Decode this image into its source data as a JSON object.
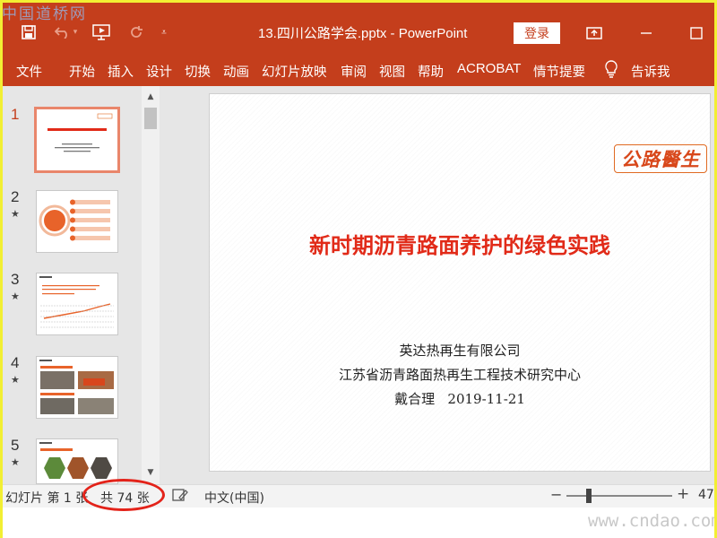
{
  "watermark": {
    "top": "中国道桥网",
    "bottom": "www.cndao.com"
  },
  "titlebar": {
    "title": "13.四川公路学会.pptx - PowerPoint",
    "login_label": "登录"
  },
  "ribbon": {
    "tabs": [
      "文件",
      "开始",
      "插入",
      "设计",
      "切换",
      "动画",
      "幻灯片放映",
      "审阅",
      "视图",
      "帮助",
      "ACROBAT",
      "情节提要"
    ],
    "tell_me": "告诉我"
  },
  "thumbnails": [
    {
      "number": "1",
      "active": true,
      "star": false
    },
    {
      "number": "2",
      "active": false,
      "star": true
    },
    {
      "number": "3",
      "active": false,
      "star": true
    },
    {
      "number": "4",
      "active": false,
      "star": true
    },
    {
      "number": "5",
      "active": false,
      "star": true
    }
  ],
  "slide": {
    "logo": "公路醫生",
    "title": "新时期沥青路面养护的绿色实践",
    "company": "英达热再生有限公司",
    "center": "江苏省沥青路面热再生工程技术研究中心",
    "author_date": "戴合理   2019-11-21"
  },
  "status": {
    "slide_info": "幻灯片 第 1 张",
    "total": "共 74 张",
    "language": "中文(中国)",
    "zoom": "47"
  },
  "colors": {
    "accent": "#c43e1c",
    "title_red": "#e12a18",
    "highlight": "#e3231a"
  }
}
